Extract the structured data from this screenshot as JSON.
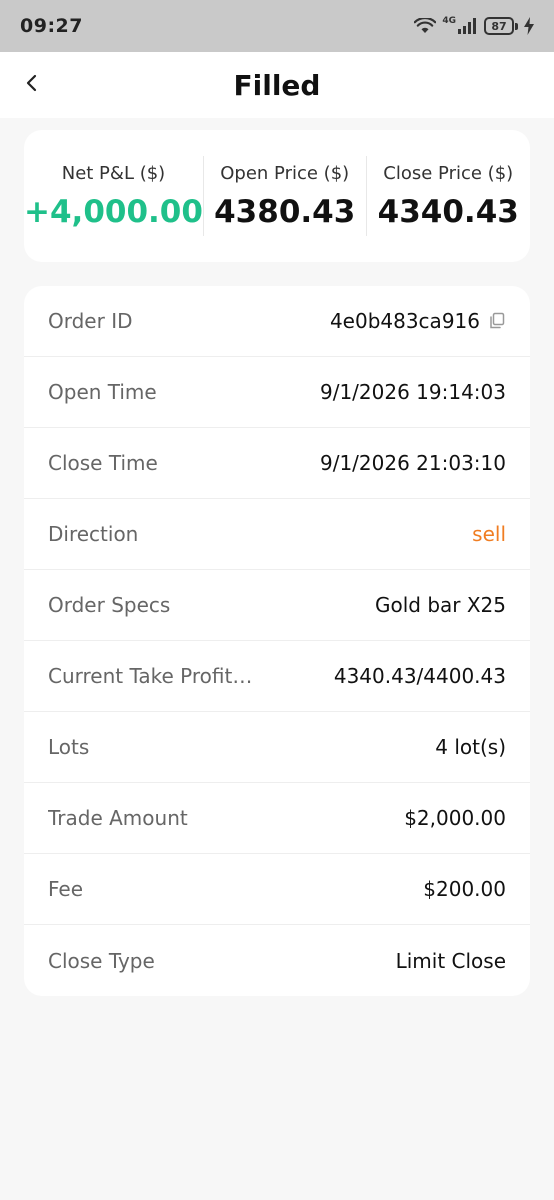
{
  "status_bar": {
    "time": "09:27",
    "network": "4G",
    "battery": "87",
    "icons": [
      "wifi-icon",
      "signal-icon",
      "battery-icon",
      "charging-icon"
    ]
  },
  "header": {
    "title": "Filled",
    "back_icon": "chevron-left-icon"
  },
  "summary": {
    "net_pl_label": "Net P&L ($)",
    "net_pl_value": "+4,000.00",
    "open_price_label": "Open Price ($)",
    "open_price_value": "4380.43",
    "close_price_label": "Close Price ($)",
    "close_price_value": "4340.43"
  },
  "details": {
    "order_id": {
      "label": "Order ID",
      "value": "4e0b483ca916"
    },
    "open_time": {
      "label": "Open Time",
      "value": "9/1/2026 19:14:03"
    },
    "close_time": {
      "label": "Close Time",
      "value": "9/1/2026 21:03:10"
    },
    "direction": {
      "label": "Direction",
      "value": "sell"
    },
    "order_specs": {
      "label": "Order Specs",
      "value": "Gold bar X25"
    },
    "take_profit": {
      "label": "Current Take Profit…",
      "value": "4340.43/4400.43"
    },
    "lots": {
      "label": "Lots",
      "value": "4 lot(s)"
    },
    "trade_amount": {
      "label": "Trade Amount",
      "value": "$2,000.00"
    },
    "fee": {
      "label": "Fee",
      "value": "$200.00"
    },
    "close_type": {
      "label": "Close Type",
      "value": "Limit Close"
    }
  },
  "colors": {
    "positive": "#1fc08a",
    "sell": "#f07d22",
    "background": "#f7f7f7",
    "status_bar": "#c9c9c9"
  }
}
